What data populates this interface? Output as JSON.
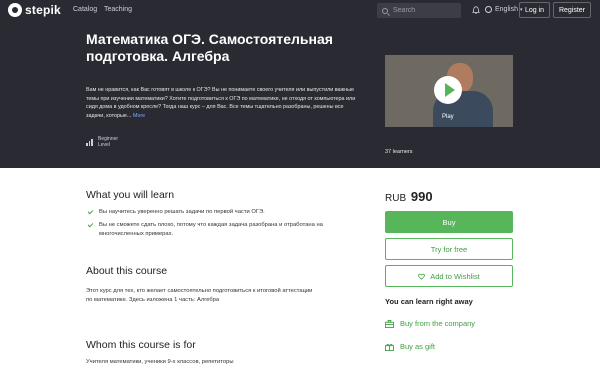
{
  "nav": {
    "logo_text": "stepik",
    "links": [
      "Catalog",
      "Teaching"
    ],
    "search_placeholder": "Search",
    "language": "English",
    "login": "Log in",
    "register": "Register"
  },
  "hero": {
    "title": "Математика ОГЭ. Самостоятельная подготовка. Алгебра",
    "description": "Вам не нравится, как Вас готовят в школе к ОГЭ? Вы не понимаете своего учителя или выпустили важные темы при изучении математики? Хотите подготовиться к ОГЭ по математике, не отходя от компьютера или сидя дома в удобном кресле? Тогда наш курс – для Вас. Все темы тщательно разобраны, решены все задачи, которые...",
    "more": "More",
    "level": "Beginner",
    "level_label": "Level",
    "video_label": "Play",
    "learners": "37 learners"
  },
  "learn": {
    "title": "What you will learn",
    "items": [
      "Вы научитесь уверенно решать задачи по первой части ОГЭ.",
      "Вы не сможете сдать плохо, потому что каждая задача разобрана и отработана на многочисленных примерах."
    ]
  },
  "about": {
    "title": "About this course",
    "text": "Этот курс для тех, кто желает самостоятельно подготовиться к итоговой аттестации по математике. Здесь изложена 1 часть:  Алгебра"
  },
  "whom": {
    "title": "Whom this course is for",
    "text": "Учителя математики, ученики 9-х классов, репетиторы"
  },
  "sidebar": {
    "currency": "RUB",
    "price": "990",
    "buy": "Buy",
    "try": "Try for free",
    "wishlist": "Add to Wishlist",
    "learn_right_away": "You can learn right away",
    "buy_company": "Buy from the company",
    "buy_gift": "Buy as gift"
  },
  "colors": {
    "accent": "#57b55a",
    "dark": "#2a2a33",
    "link": "#7aa7ff"
  },
  "icons": [
    "search-icon",
    "bell-icon",
    "globe-icon",
    "level-icon",
    "play-icon",
    "check-icon",
    "heart-icon",
    "company-icon",
    "gift-icon"
  ]
}
